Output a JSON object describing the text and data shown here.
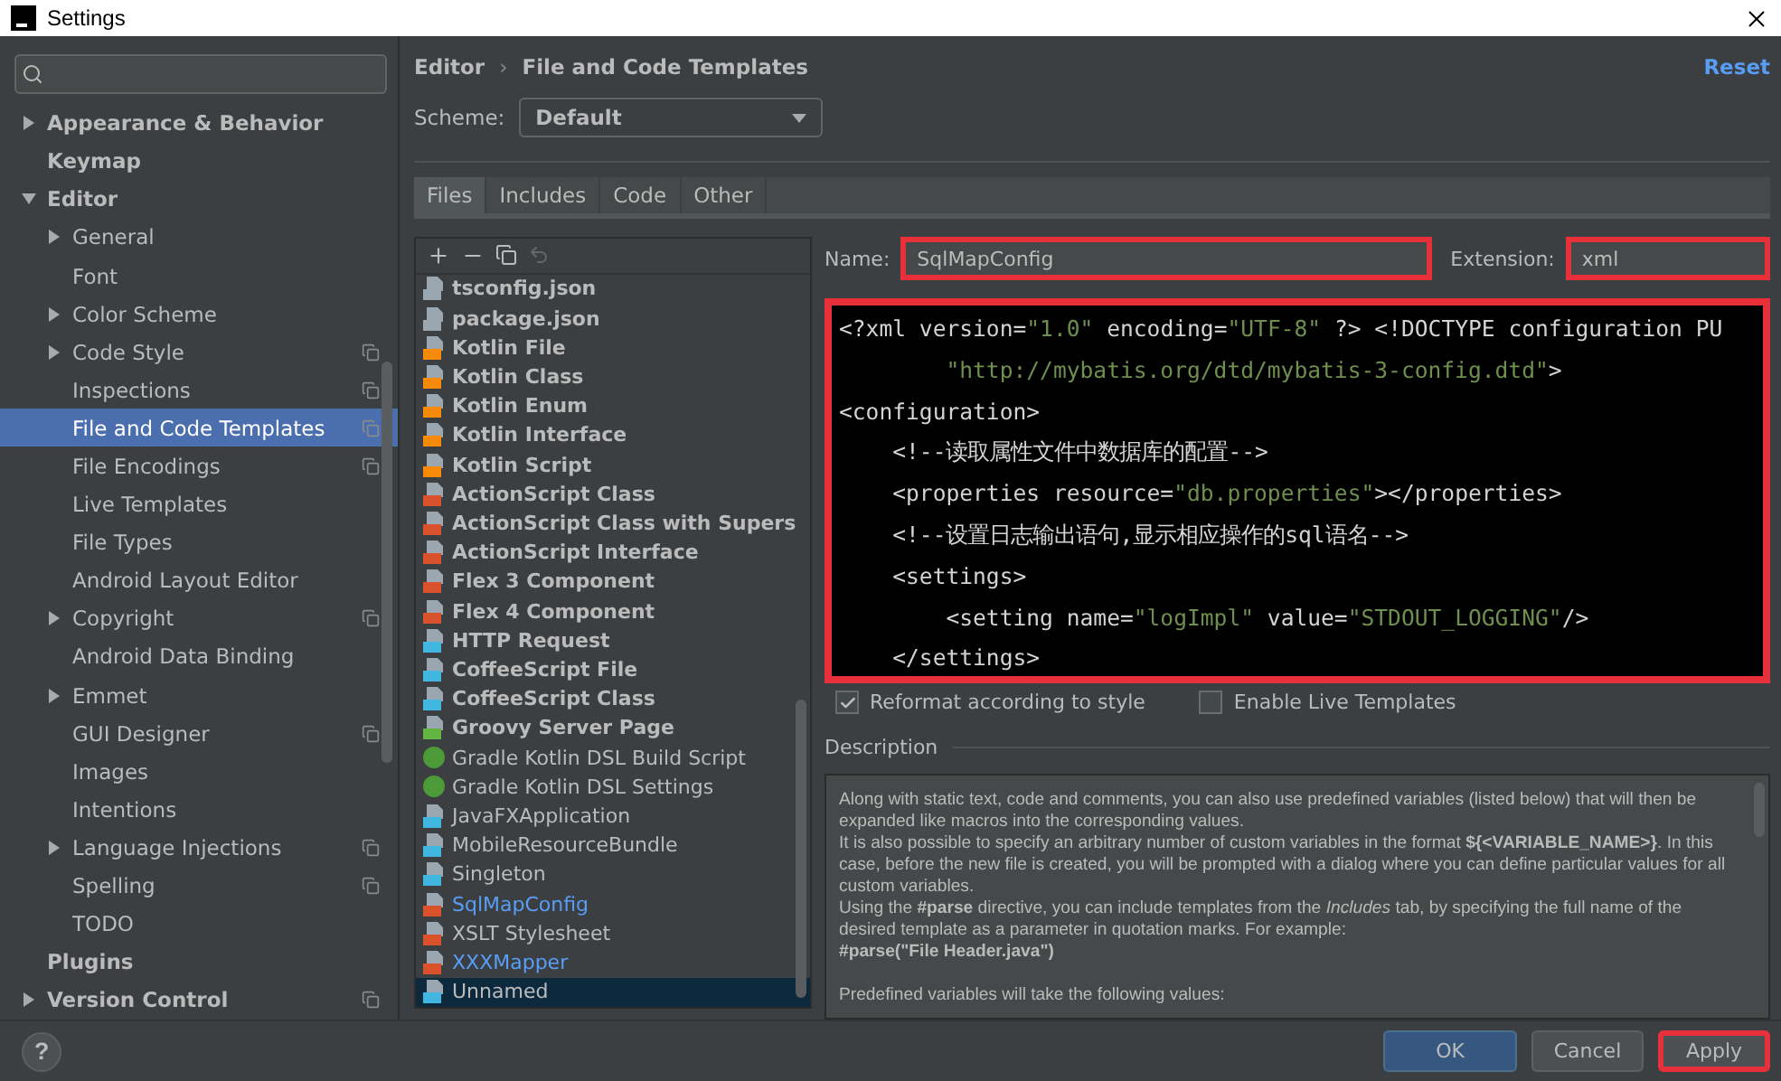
{
  "window": {
    "title": "Settings"
  },
  "sidebar": {
    "tree": [
      {
        "label": "Appearance & Behavior",
        "bold": true,
        "expanded": false,
        "selected": false
      },
      {
        "label": "Keymap",
        "bold": true,
        "selected": false
      },
      {
        "label": "Editor",
        "bold": true,
        "expanded": true,
        "selected": false,
        "children": [
          {
            "label": "General",
            "expanded": false,
            "selected": false
          },
          {
            "label": "Font",
            "selected": false
          },
          {
            "label": "Color Scheme",
            "expanded": false,
            "selected": false
          },
          {
            "label": "Code Style",
            "expanded": false,
            "project_scope": true,
            "selected": false
          },
          {
            "label": "Inspections",
            "project_scope": true,
            "selected": false
          },
          {
            "label": "File and Code Templates",
            "project_scope": true,
            "selected": true
          },
          {
            "label": "File Encodings",
            "project_scope": true,
            "selected": false
          },
          {
            "label": "Live Templates",
            "selected": false
          },
          {
            "label": "File Types",
            "selected": false
          },
          {
            "label": "Android Layout Editor",
            "selected": false
          },
          {
            "label": "Copyright",
            "expanded": false,
            "project_scope": true,
            "selected": false
          },
          {
            "label": "Android Data Binding",
            "selected": false
          },
          {
            "label": "Emmet",
            "expanded": false,
            "selected": false
          },
          {
            "label": "GUI Designer",
            "project_scope": true,
            "selected": false
          },
          {
            "label": "Images",
            "selected": false
          },
          {
            "label": "Intentions",
            "selected": false
          },
          {
            "label": "Language Injections",
            "expanded": false,
            "project_scope": true,
            "selected": false
          },
          {
            "label": "Spelling",
            "project_scope": true,
            "selected": false
          },
          {
            "label": "TODO",
            "selected": false
          }
        ]
      },
      {
        "label": "Plugins",
        "bold": true,
        "selected": false
      },
      {
        "label": "Version Control",
        "bold": true,
        "expanded": false,
        "project_scope": true,
        "selected": false
      }
    ]
  },
  "header": {
    "breadcrumb": [
      "Editor",
      "File and Code Templates"
    ],
    "separator": "›",
    "reset": "Reset",
    "scheme_label": "Scheme:",
    "scheme": "Default"
  },
  "tabs": [
    {
      "label": "Files",
      "selected": true
    },
    {
      "label": "Includes",
      "selected": false
    },
    {
      "label": "Code",
      "selected": false
    },
    {
      "label": "Other",
      "selected": false
    }
  ],
  "template_list": {
    "items": [
      {
        "name": "tsconfig.json",
        "kind": "json",
        "bold": true,
        "custom": false,
        "selected": false
      },
      {
        "name": "package.json",
        "kind": "json",
        "bold": true,
        "custom": false,
        "selected": false
      },
      {
        "name": "Kotlin File",
        "kind": "kotlin",
        "bold": true,
        "custom": false,
        "selected": false
      },
      {
        "name": "Kotlin Class",
        "kind": "kotlin",
        "bold": true,
        "custom": false,
        "selected": false
      },
      {
        "name": "Kotlin Enum",
        "kind": "kotlin",
        "bold": true,
        "custom": false,
        "selected": false
      },
      {
        "name": "Kotlin Interface",
        "kind": "kotlin",
        "bold": true,
        "custom": false,
        "selected": false
      },
      {
        "name": "Kotlin Script",
        "kind": "kotlin",
        "bold": true,
        "custom": false,
        "selected": false
      },
      {
        "name": "ActionScript Class",
        "kind": "actionscript",
        "bold": true,
        "custom": false,
        "selected": false
      },
      {
        "name": "ActionScript Class with Supers",
        "kind": "actionscript",
        "bold": true,
        "custom": false,
        "selected": false
      },
      {
        "name": "ActionScript Interface",
        "kind": "actionscript",
        "bold": true,
        "custom": false,
        "selected": false
      },
      {
        "name": "Flex 3 Component",
        "kind": "markup",
        "bold": true,
        "custom": false,
        "selected": false
      },
      {
        "name": "Flex 4 Component",
        "kind": "markup",
        "bold": true,
        "custom": false,
        "selected": false
      },
      {
        "name": "HTTP Request",
        "kind": "api",
        "bold": true,
        "custom": false,
        "selected": false
      },
      {
        "name": "CoffeeScript File",
        "kind": "coffee",
        "bold": true,
        "custom": false,
        "selected": false
      },
      {
        "name": "CoffeeScript Class",
        "kind": "coffee",
        "bold": true,
        "custom": false,
        "selected": false
      },
      {
        "name": "Groovy Server Page",
        "kind": "groovy",
        "bold": true,
        "custom": false,
        "selected": false
      },
      {
        "name": "Gradle Kotlin DSL Build Script",
        "kind": "gradle",
        "bold": false,
        "custom": false,
        "selected": false
      },
      {
        "name": "Gradle Kotlin DSL Settings",
        "kind": "gradle",
        "bold": false,
        "custom": false,
        "selected": false
      },
      {
        "name": "JavaFXApplication",
        "kind": "java",
        "bold": false,
        "custom": false,
        "selected": false
      },
      {
        "name": "MobileResourceBundle",
        "kind": "java",
        "bold": false,
        "custom": false,
        "selected": false
      },
      {
        "name": "Singleton",
        "kind": "java",
        "bold": false,
        "custom": false,
        "selected": false
      },
      {
        "name": "SqlMapConfig",
        "kind": "markup",
        "bold": false,
        "custom": true,
        "selected": false
      },
      {
        "name": "XSLT Stylesheet",
        "kind": "markup",
        "bold": false,
        "custom": false,
        "selected": false
      },
      {
        "name": "XXXMapper",
        "kind": "markup",
        "bold": false,
        "custom": true,
        "selected": false
      },
      {
        "name": "Unnamed",
        "kind": "java",
        "bold": false,
        "custom": false,
        "selected": true
      }
    ]
  },
  "editor": {
    "name_label": "Name:",
    "name": "SqlMapConfig",
    "name_highlighted": true,
    "extension_label": "Extension:",
    "extension": "xml",
    "extension_highlighted": true,
    "code_highlighted": true,
    "code": [
      [
        {
          "kind": "plain",
          "text": "<?xml version="
        },
        {
          "kind": "string",
          "text": "\"1.0\""
        },
        {
          "kind": "plain",
          "text": " encoding="
        },
        {
          "kind": "string",
          "text": "\"UTF-8\""
        },
        {
          "kind": "plain",
          "text": " ?> <!DOCTYPE configuration PU"
        }
      ],
      [
        {
          "kind": "string",
          "text": "        \"http://mybatis.org/dtd/mybatis-3-config.dtd\""
        },
        {
          "kind": "plain",
          "text": ">"
        }
      ],
      [
        {
          "kind": "plain",
          "text": "<configuration>"
        }
      ],
      [
        {
          "kind": "plain",
          "text": "    <!--读取属性文件中数据库的配置-->"
        }
      ],
      [
        {
          "kind": "plain",
          "text": "    <properties resource="
        },
        {
          "kind": "string",
          "text": "\"db.properties\""
        },
        {
          "kind": "plain",
          "text": "></properties>"
        }
      ],
      [
        {
          "kind": "plain",
          "text": "    <!--设置日志输出语句,显示相应操作的sql语名-->"
        }
      ],
      [
        {
          "kind": "plain",
          "text": "    <settings>"
        }
      ],
      [
        {
          "kind": "plain",
          "text": "        <setting name="
        },
        {
          "kind": "string",
          "text": "\"logImpl\""
        },
        {
          "kind": "plain",
          "text": " value="
        },
        {
          "kind": "string",
          "text": "\"STDOUT_LOGGING\""
        },
        {
          "kind": "plain",
          "text": "/>"
        }
      ],
      [
        {
          "kind": "plain",
          "text": "    </settings>"
        }
      ]
    ],
    "options": [
      {
        "label": "Reformat according to style",
        "checked": true
      },
      {
        "label": "Enable Live Templates",
        "checked": false
      }
    ]
  },
  "description": {
    "title": "Description",
    "paragraphs": [
      "Along with static text, code and comments, you can also use predefined variables (listed below) that will then be expanded like macros into the corresponding values.",
      "It is also possible to specify an arbitrary number of custom variables in the format **${<VARIABLE_NAME>}**. In this case, before the new file is created, you will be prompted with a dialog where you can define particular values for all custom variables.",
      "Using the **#parse** directive, you can include templates from the *Includes* tab, by specifying the full name of the desired template as a parameter in quotation marks. For example:"
    ],
    "example": "#parse(\"File Header.java\")",
    "footer": "Predefined variables will take the following values:"
  },
  "footer": {
    "help": "?",
    "buttons": [
      {
        "label": "OK",
        "kind": "default",
        "highlighted": false
      },
      {
        "label": "Cancel",
        "kind": "normal",
        "highlighted": false
      },
      {
        "label": "Apply",
        "kind": "normal",
        "highlighted": true
      }
    ]
  }
}
